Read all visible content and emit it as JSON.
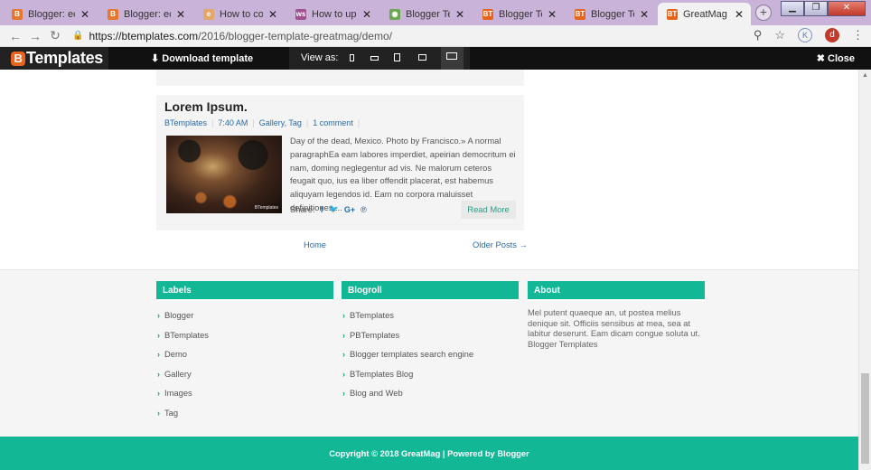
{
  "browser": {
    "tabs": [
      {
        "title": "Blogger: eclipse",
        "fav": "B",
        "fav_color": "#e8772e",
        "active": false
      },
      {
        "title": "Blogger: eclipse",
        "fav": "B",
        "fav_color": "#e8772e",
        "active": false
      },
      {
        "title": "How to configu",
        "fav": "e",
        "fav_color": "#e3a66b",
        "active": false
      },
      {
        "title": "How to upload",
        "fav": "ws",
        "fav_color": "#a0528f",
        "active": false
      },
      {
        "title": "Blogger Templ",
        "fav": "◉",
        "fav_color": "#6aa84f",
        "active": false
      },
      {
        "title": "Blogger Templ",
        "fav": "BT",
        "fav_color": "#e8641b",
        "active": false
      },
      {
        "title": "Blogger Templ",
        "fav": "BT",
        "fav_color": "#e8641b",
        "active": false
      },
      {
        "title": "GreatMag Blog",
        "fav": "BT",
        "fav_color": "#e8641b",
        "active": true
      }
    ],
    "close_glyph": "✕",
    "new_tab": "+",
    "url_host": "https://btemplates.com",
    "url_path": "/2016/blogger-template-greatmag/demo/",
    "avatar_letter": "d",
    "k_letter": "K"
  },
  "demobar": {
    "logo_b": "B",
    "logo_text": "Templates",
    "download": "Download template",
    "view_as": "View as:",
    "close": "Close"
  },
  "post": {
    "title": "Lorem Ipsum.",
    "author": "BTemplates",
    "time": "7:40 AM",
    "labels": "Gallery, Tag",
    "comments": "1 comment",
    "excerpt": "Day of the dead, Mexico. Photo by Francisco.» A normal paragraphEa eam labores imperdiet, apeirian democritum ei nam, doming neglegentur ad vis. Ne malorum ceteros feugait quo, ius ea liber offendit placerat, est habemus aliquyam legendos id. Eam no corpora maluisset definitiones,...",
    "share_label": "Share:",
    "read_more": "Read More",
    "thumb_watermark": "BTemplates"
  },
  "pager": {
    "home": "Home",
    "older": "Older Posts →"
  },
  "widgets": {
    "labels_title": "Labels",
    "labels": [
      "Blogger",
      "BTemplates",
      "Demo",
      "Gallery",
      "Images",
      "Tag"
    ],
    "blogroll_title": "Blogroll",
    "blogroll": [
      "BTemplates",
      "PBTemplates",
      "Blogger templates search engine",
      "BTemplates Blog",
      "Blog and Web"
    ],
    "about_title": "About",
    "about_text": "Mel putent quaeque an, ut postea melius denique sit. Officiis sensibus at mea, sea at labitur deserunt. Eam dicam congue soluta ut. Blogger Templates"
  },
  "footer": {
    "copyright": "Copyright © 2018 GreatMag | Powered by Blogger"
  },
  "colors": {
    "accent": "#12b796",
    "link": "#2a6aa8"
  }
}
